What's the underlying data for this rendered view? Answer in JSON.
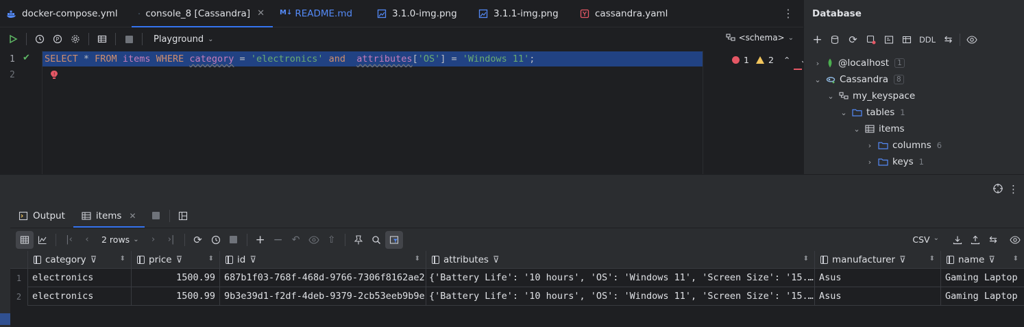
{
  "tabs": [
    {
      "label": "docker-compose.yml",
      "icon": "docker-icon",
      "color": "#548af7"
    },
    {
      "label": "console_8 [Cassandra]",
      "icon": "cassandra-icon",
      "active": true
    },
    {
      "label": "README.md",
      "icon": "markdown-icon"
    },
    {
      "label": "3.1.0-img.png",
      "icon": "image-icon"
    },
    {
      "label": "3.1.1-img.png",
      "icon": "image-icon"
    },
    {
      "label": "cassandra.yaml",
      "icon": "yaml-icon"
    }
  ],
  "editor_toolbar": {
    "playground": "Playground",
    "schema": "<schema>"
  },
  "editor": {
    "line_numbers": [
      "1",
      "2"
    ],
    "code": {
      "select": "SELECT",
      "star": " * ",
      "from": "FROM",
      "table": "items",
      "where": "WHERE",
      "col1": "category",
      "eq1": " = ",
      "val1": "'electronics'",
      "and": "and",
      "col2": "attributes",
      "bracket_open": "[",
      "key": "'OS'",
      "bracket_close": "]",
      "eq2": " = ",
      "val2": "'Windows 11'",
      "semi": ";"
    },
    "errors": "1",
    "warnings": "2"
  },
  "database_panel": {
    "title": "Database",
    "ddl": "DDL",
    "tree": [
      {
        "label": "@localhost",
        "count": "1"
      },
      {
        "label": "Cassandra",
        "count": "8"
      },
      {
        "label": "my_keyspace"
      },
      {
        "label": "tables",
        "count": "1"
      },
      {
        "label": "items"
      },
      {
        "label": "columns",
        "count": "6"
      },
      {
        "label": "keys",
        "count": "1"
      }
    ]
  },
  "results": {
    "tabs": [
      {
        "label": "Output"
      },
      {
        "label": "items",
        "active": true
      }
    ],
    "rows_selector": "2 rows",
    "export_format": "CSV",
    "columns": [
      "category",
      "price",
      "id",
      "attributes",
      "manufacturer",
      "name"
    ],
    "rows": [
      {
        "num": "1",
        "category": "electronics",
        "price": "1500.99",
        "id": "687b1f03-768f-468d-9766-7306f8162ae2",
        "attributes": "{'Battery Life': '10 hours', 'OS': 'Windows 11', 'Screen Size': '15.…",
        "manufacturer": "Asus",
        "name": "Gaming Laptop"
      },
      {
        "num": "2",
        "category": "electronics",
        "price": "1500.99",
        "id": "9b3e39d1-f2df-4deb-9379-2cb53eeb9b9e",
        "attributes": "{'Battery Life': '10 hours', 'OS': 'Windows 11', 'Screen Size': '15.…",
        "manufacturer": "Asus",
        "name": "Gaming Laptop"
      }
    ]
  },
  "colors": {
    "accent": "#3574f0",
    "selection": "#214283",
    "keyword": "#cf8e6d",
    "identifier": "#c77dbb",
    "string": "#6aab73",
    "error": "#e55765",
    "warning": "#f2c55c"
  }
}
